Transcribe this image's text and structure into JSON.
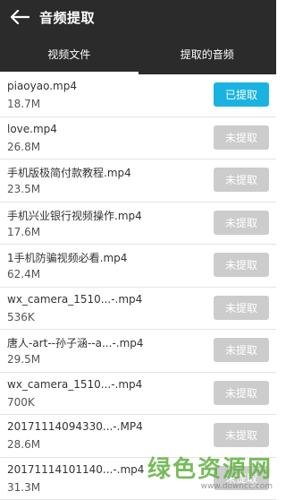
{
  "header": {
    "title": "音频提取"
  },
  "tabs": [
    {
      "label": "视频文件"
    },
    {
      "label": "提取的音频"
    }
  ],
  "items": [
    {
      "name": "piaoyao.mp4",
      "size": "18.7M",
      "button": "已提取"
    },
    {
      "name": "love.mp4",
      "size": "26.8M",
      "button": "未提取"
    },
    {
      "name": "手机版极简付款教程.mp4",
      "size": "23.5M",
      "button": "未提取"
    },
    {
      "name": "手机兴业银行视频操作.mp4",
      "size": "17.6M",
      "button": "未提取"
    },
    {
      "name": "1手机防骗视频必看.mp4",
      "size": "62.4M",
      "button": "未提取"
    },
    {
      "name": "wx_camera_1510...-.mp4",
      "size": "536K",
      "button": "未提取"
    },
    {
      "name": "唐人-art--孙子涵--a...-.mp4",
      "size": "29.5M",
      "button": "未提取"
    },
    {
      "name": "wx_camera_1510...-.mp4",
      "size": "700K",
      "button": "未提取"
    },
    {
      "name": "20171114094330...-.MP4",
      "size": "28.6M",
      "button": "未提取"
    },
    {
      "name": "20171114101140...-.mp4",
      "size": "31.3M",
      "button": "未提取"
    }
  ],
  "watermark": {
    "main": "绿色资源网",
    "sub": "www.downcc.com"
  }
}
